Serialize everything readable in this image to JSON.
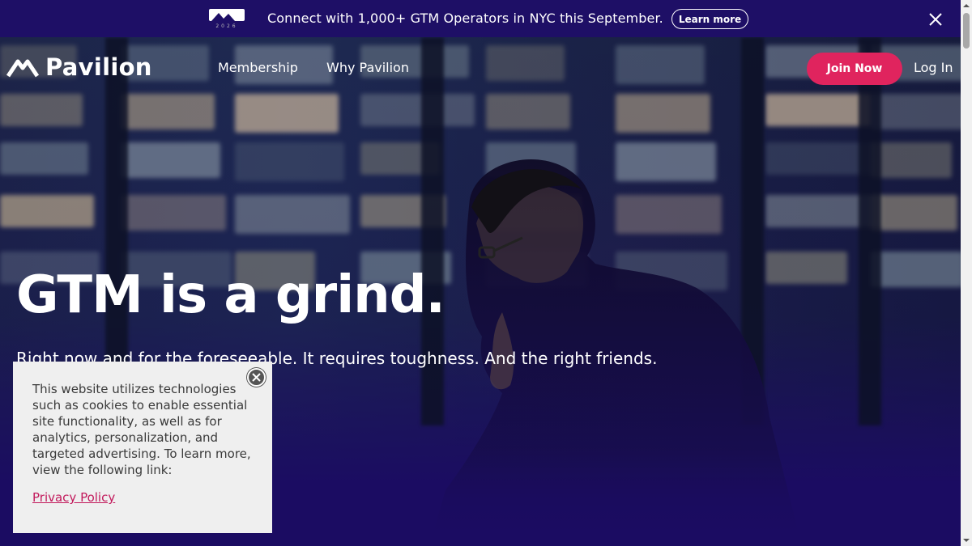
{
  "announcement": {
    "logo_text": "GTM",
    "logo_year": "2026",
    "text": "Connect with 1,000+ GTM Operators in NYC this September.",
    "cta_label": "Learn more"
  },
  "nav": {
    "brand": "Pavilion",
    "links": [
      "Membership",
      "Why Pavilion"
    ],
    "join_label": "Join Now",
    "login_label": "Log In"
  },
  "hero": {
    "headline": "GTM is a grind.",
    "subhead": "Right now and for the foreseeable. It requires toughness. And the right friends."
  },
  "cookie": {
    "text": "This website utilizes technologies such as cookies to enable essential site functionality, as well as for analytics, personalization, and targeted advertising. To learn more, view the following link:",
    "link_label": "Privacy Policy"
  },
  "colors": {
    "announcement_bg": "#1e0f66",
    "hero_bg": "#1b0c62",
    "accent": "#e0245e",
    "cookie_bg": "#efefef",
    "link": "#c2185b"
  }
}
